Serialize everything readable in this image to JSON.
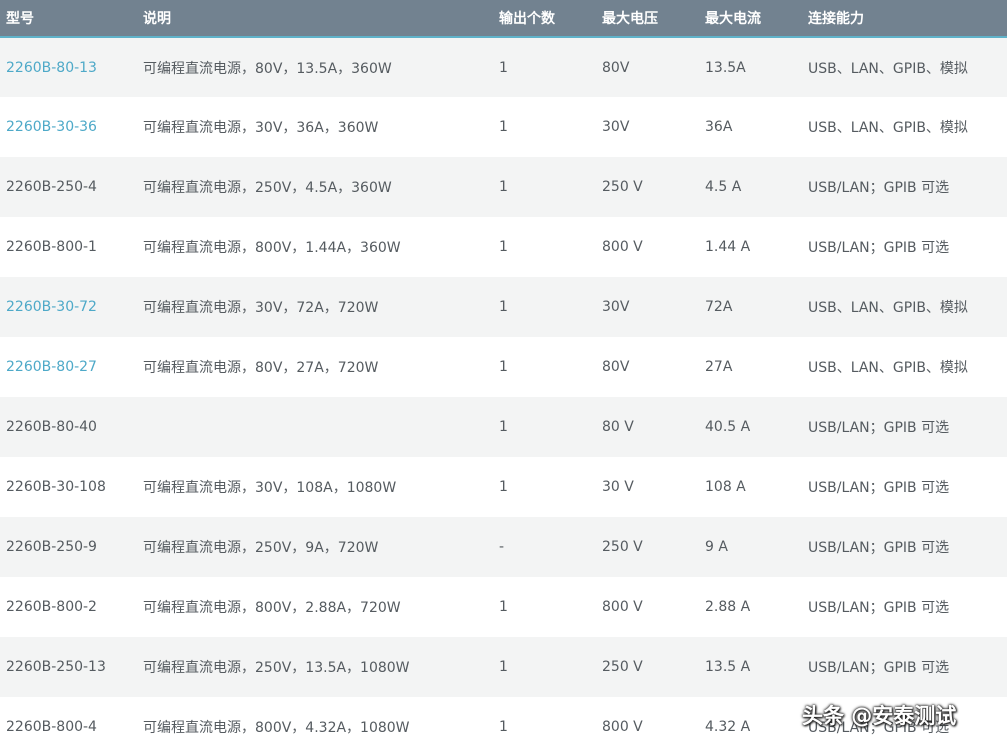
{
  "table": {
    "headers": [
      "型号",
      "说明",
      "输出个数",
      "最大电压",
      "最大电流",
      "连接能力"
    ],
    "rows": [
      {
        "model": "2260B-80-13",
        "link": true,
        "desc": "可编程直流电源，80V，13.5A，360W",
        "outputs": "1",
        "voltage": "80V",
        "current": "13.5A",
        "connectivity": "USB、LAN、GPIB、模拟"
      },
      {
        "model": "2260B-30-36",
        "link": true,
        "desc": "可编程直流电源，30V，36A，360W",
        "outputs": "1",
        "voltage": "30V",
        "current": "36A",
        "connectivity": "USB、LAN、GPIB、模拟"
      },
      {
        "model": "2260B-250-4",
        "link": false,
        "desc": "可编程直流电源，250V，4.5A，360W",
        "outputs": "1",
        "voltage": "250 V",
        "current": "4.5 A",
        "connectivity": "USB/LAN；GPIB 可选"
      },
      {
        "model": "2260B-800-1",
        "link": false,
        "desc": "可编程直流电源，800V，1.44A，360W",
        "outputs": "1",
        "voltage": "800 V",
        "current": "1.44 A",
        "connectivity": "USB/LAN；GPIB 可选"
      },
      {
        "model": "2260B-30-72",
        "link": true,
        "desc": "可编程直流电源，30V，72A，720W",
        "outputs": "1",
        "voltage": "30V",
        "current": "72A",
        "connectivity": "USB、LAN、GPIB、模拟"
      },
      {
        "model": "2260B-80-27",
        "link": true,
        "desc": "可编程直流电源，80V，27A，720W",
        "outputs": "1",
        "voltage": "80V",
        "current": "27A",
        "connectivity": "USB、LAN、GPIB、模拟"
      },
      {
        "model": "2260B-80-40",
        "link": false,
        "desc": "",
        "outputs": "1",
        "voltage": "80 V",
        "current": "40.5 A",
        "connectivity": "USB/LAN；GPIB 可选"
      },
      {
        "model": "2260B-30-108",
        "link": false,
        "desc": "可编程直流电源，30V，108A，1080W",
        "outputs": "1",
        "voltage": "30 V",
        "current": "108 A",
        "connectivity": "USB/LAN；GPIB 可选"
      },
      {
        "model": "2260B-250-9",
        "link": false,
        "desc": "可编程直流电源，250V，9A，720W",
        "outputs": "-",
        "voltage": "250 V",
        "current": "9 A",
        "connectivity": "USB/LAN；GPIB 可选"
      },
      {
        "model": "2260B-800-2",
        "link": false,
        "desc": "可编程直流电源，800V，2.88A，720W",
        "outputs": "1",
        "voltage": "800 V",
        "current": "2.88 A",
        "connectivity": "USB/LAN；GPIB 可选"
      },
      {
        "model": "2260B-250-13",
        "link": false,
        "desc": "可编程直流电源，250V，13.5A，1080W",
        "outputs": "1",
        "voltage": "250 V",
        "current": "13.5 A",
        "connectivity": "USB/LAN；GPIB 可选"
      },
      {
        "model": "2260B-800-4",
        "link": false,
        "desc": "可编程直流电源，800V，4.32A，1080W",
        "outputs": "1",
        "voltage": "800 V",
        "current": "4.32 A",
        "connectivity": "USB/LAN；GPIB 可选"
      }
    ]
  },
  "watermark": "头条 @安泰测试",
  "colors": {
    "header_bg": "#728290",
    "header_border": "#5fb2c9",
    "link": "#4ea9c8",
    "row_alt": "#f3f4f4",
    "text": "#555b60"
  }
}
